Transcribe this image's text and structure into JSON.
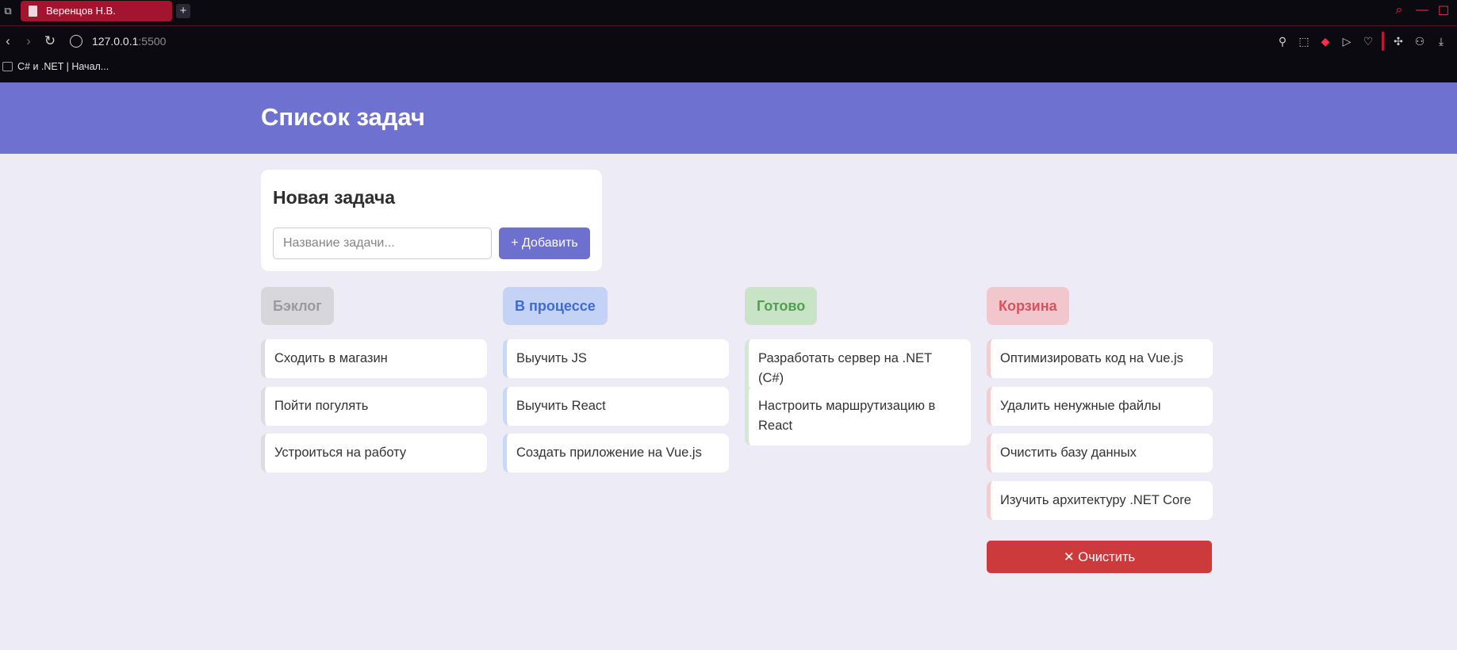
{
  "browser": {
    "tab_title": "Веренцов Н.В.",
    "new_tab_symbol": "+",
    "url_host": "127.0.0.1",
    "url_port": ":5500",
    "bookmark_label": "C# и .NET | Начал..."
  },
  "header": {
    "title": "Список задач"
  },
  "new_task": {
    "title": "Новая задача",
    "placeholder": "Название задачи...",
    "add_label": "+ Добавить"
  },
  "columns": [
    {
      "title": "Бэклог",
      "badge_bg": "#d6d6db",
      "badge_color": "#9a9a9e",
      "accent": "#dcdce2",
      "tasks": [
        "Сходить в магазин",
        "Пойти погулять",
        "Устроиться на работу"
      ]
    },
    {
      "title": "В процессе",
      "badge_bg": "#c4d3f5",
      "badge_color": "#3c6bd6",
      "accent": "#cbd8f5",
      "tasks": [
        "Выучить JS",
        "Выучить React",
        "Создать приложение на Vue.js"
      ]
    },
    {
      "title": "Готово",
      "badge_bg": "#c9e3c6",
      "badge_color": "#4fa14d",
      "accent": "#d3e9cf",
      "tasks": [
        "Разработать сервер на .NET (C#)",
        "Настроить маршрутизацию в React"
      ]
    },
    {
      "title": "Корзина",
      "badge_bg": "#f1c7cd",
      "badge_color": "#d7525c",
      "accent": "#f3cdd2",
      "tasks": [
        "Оптимизировать код на Vue.js",
        "Удалить ненужные файлы",
        "Очистить базу данных",
        "Изучить архитектуру .NET Core"
      ]
    }
  ],
  "trash": {
    "clear_label": "✕ Очистить"
  }
}
